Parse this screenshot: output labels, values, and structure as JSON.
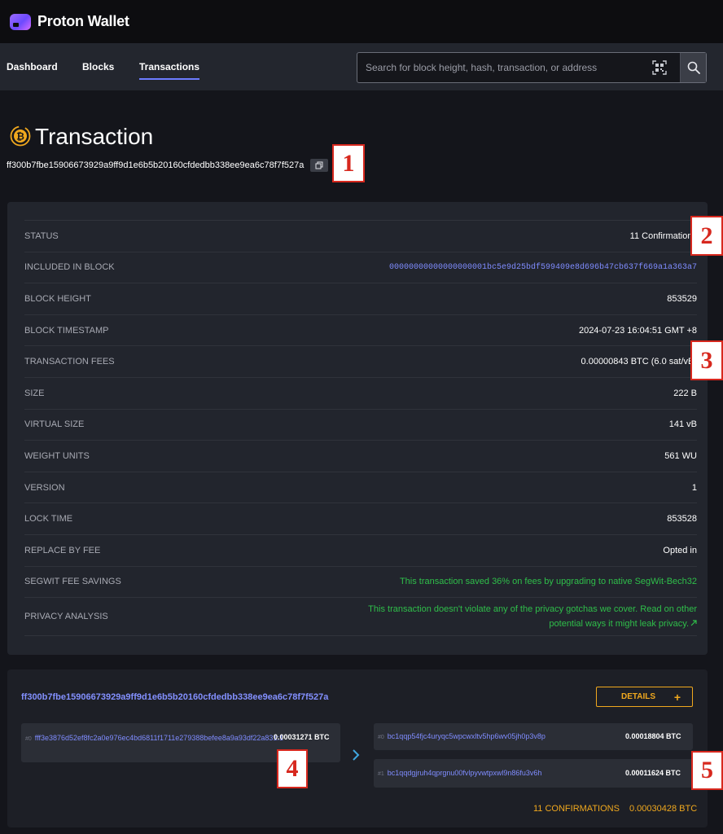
{
  "app": {
    "name": "Proton Wallet"
  },
  "nav": {
    "items": [
      {
        "label": "Dashboard",
        "active": false
      },
      {
        "label": "Blocks",
        "active": false
      },
      {
        "label": "Transactions",
        "active": true
      }
    ]
  },
  "search": {
    "placeholder": "Search for block height, hash, transaction, or address"
  },
  "page": {
    "title": "Transaction",
    "txid": "ff300b7fbe15906673929a9ff9d1e6b5b20160cfdedbb338ee9ea6c78f7f527a"
  },
  "details": {
    "rows": [
      {
        "label": "Status",
        "value": "11 Confirmations"
      },
      {
        "label": "Included in block",
        "value": "00000000000000000001bc5e9d25bdf599409e8d696b47cb637f669a1a363a7"
      },
      {
        "label": "Block height",
        "value": "853529"
      },
      {
        "label": "Block timestamp",
        "value": "2024-07-23 16:04:51 GMT +8"
      },
      {
        "label": "Transaction fees",
        "value": "0.00000843 BTC (6.0 sat/vB)"
      },
      {
        "label": "Size",
        "value": "222 B"
      },
      {
        "label": "Virtual size",
        "value": "141 vB"
      },
      {
        "label": "Weight units",
        "value": "561 WU"
      },
      {
        "label": "Version",
        "value": "1"
      },
      {
        "label": "Lock time",
        "value": "853528"
      },
      {
        "label": "Replace by fee",
        "value": "Opted in"
      },
      {
        "label": "Segwit fee savings",
        "value": "This transaction saved 36% on fees by upgrading to native SegWit-Bech32"
      },
      {
        "label": "Privacy analysis",
        "value": "This transaction doesn't violate any of the privacy gotchas we cover. Read on other potential ways it might leak privacy."
      }
    ]
  },
  "flow": {
    "txid": "ff300b7fbe15906673929a9ff9d1e6b5b20160cfdedbb338ee9ea6c78f7f527a",
    "details_label": "DETAILS",
    "input": {
      "index": "#0",
      "address": "fff3e3876d52ef8fc2a0e976ec4bd6811f1711e279388befee8a9a93df22a831:1",
      "amount": "0.00031271 BTC"
    },
    "outputs": [
      {
        "index": "#0",
        "address": "bc1qqp54fjc4uryqc5wpcwxltv5hp6wv05jh0p3v8p",
        "amount": "0.00018804 BTC"
      },
      {
        "index": "#1",
        "address": "bc1qqdgjruh4qprgnu00fvlpyvwtpxwl9n86fu3v6h",
        "amount": "0.00011624 BTC"
      }
    ],
    "confirmations": "11 CONFIRMATIONS",
    "total": "0.00030428 BTC"
  },
  "callouts": [
    "1",
    "2",
    "3",
    "4",
    "5"
  ],
  "colors": {
    "accent": "#7f8cff",
    "amber": "#f0a81e",
    "green": "#2fbf4a",
    "callout": "#d7281e"
  }
}
